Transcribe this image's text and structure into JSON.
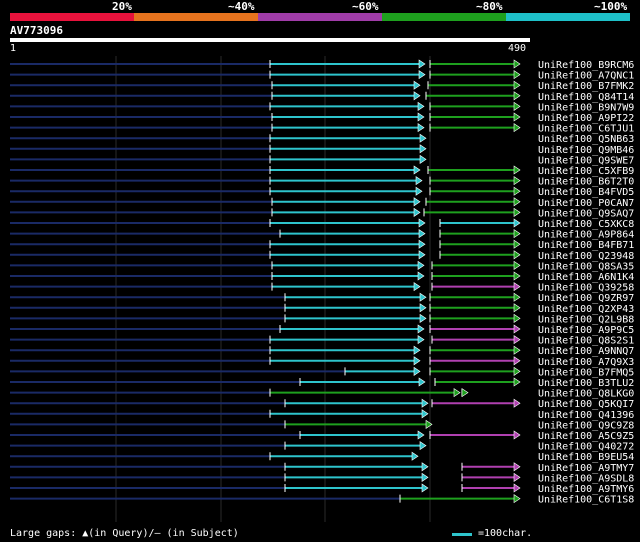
{
  "legend": {
    "colors": [
      "#e8123c",
      "#e6731e",
      "#a03ca8",
      "#1ea01e",
      "#1ec0c8"
    ],
    "labels": [
      "20%",
      "~40%",
      "~60%",
      "~80%",
      "~100%"
    ]
  },
  "query": {
    "id": "AV773096",
    "start": "1",
    "end": "490",
    "length": 490
  },
  "identity_colors": {
    "cyan": "#2ec4cc",
    "green": "#1ea01e",
    "magenta": "#b040b0",
    "navy": "#1a2a66"
  },
  "hits": [
    {
      "name": "UniRef100_B9RCM6",
      "segs": [
        [
          270,
          425,
          "cyan"
        ],
        [
          430,
          520,
          "green"
        ]
      ]
    },
    {
      "name": "UniRef100_A7QNC1",
      "segs": [
        [
          270,
          425,
          "cyan"
        ],
        [
          430,
          520,
          "green"
        ]
      ]
    },
    {
      "name": "UniRef100_B7FMK2",
      "segs": [
        [
          272,
          420,
          "cyan"
        ],
        [
          428,
          520,
          "green"
        ]
      ]
    },
    {
      "name": "UniRef100_Q84T14",
      "segs": [
        [
          272,
          420,
          "cyan"
        ],
        [
          426,
          520,
          "green"
        ]
      ]
    },
    {
      "name": "UniRef100_B9N7W9",
      "segs": [
        [
          270,
          424,
          "cyan"
        ],
        [
          430,
          520,
          "green"
        ]
      ]
    },
    {
      "name": "UniRef100_A9PI22",
      "segs": [
        [
          272,
          424,
          "cyan"
        ],
        [
          430,
          520,
          "green"
        ]
      ]
    },
    {
      "name": "UniRef100_C6TJU1",
      "segs": [
        [
          272,
          424,
          "cyan"
        ],
        [
          430,
          520,
          "green"
        ]
      ]
    },
    {
      "name": "UniRef100_Q5NB63",
      "segs": [
        [
          270,
          426,
          "cyan"
        ]
      ]
    },
    {
      "name": "UniRef100_Q9MB46",
      "segs": [
        [
          270,
          426,
          "cyan"
        ]
      ]
    },
    {
      "name": "UniRef100_Q9SWE7",
      "segs": [
        [
          270,
          426,
          "cyan"
        ]
      ]
    },
    {
      "name": "UniRef100_C5XFB9",
      "segs": [
        [
          270,
          420,
          "cyan"
        ],
        [
          428,
          520,
          "green"
        ]
      ]
    },
    {
      "name": "UniRef100_B6T2T0",
      "segs": [
        [
          270,
          422,
          "cyan"
        ],
        [
          430,
          520,
          "green"
        ]
      ]
    },
    {
      "name": "UniRef100_B4FVD5",
      "segs": [
        [
          270,
          422,
          "cyan"
        ],
        [
          430,
          520,
          "green"
        ]
      ]
    },
    {
      "name": "UniRef100_P0CAN7",
      "segs": [
        [
          272,
          420,
          "cyan"
        ],
        [
          426,
          520,
          "green"
        ]
      ]
    },
    {
      "name": "UniRef100_Q9SAQ7",
      "segs": [
        [
          272,
          420,
          "cyan"
        ],
        [
          424,
          520,
          "green"
        ]
      ]
    },
    {
      "name": "UniRef100_C5XKC8",
      "segs": [
        [
          270,
          425,
          "cyan"
        ],
        [
          440,
          520,
          "cyan"
        ]
      ]
    },
    {
      "name": "UniRef100_A9P864",
      "segs": [
        [
          280,
          425,
          "cyan"
        ],
        [
          440,
          520,
          "green"
        ]
      ]
    },
    {
      "name": "UniRef100_B4FB71",
      "segs": [
        [
          270,
          425,
          "cyan"
        ],
        [
          440,
          520,
          "green"
        ]
      ]
    },
    {
      "name": "UniRef100_Q23948",
      "segs": [
        [
          270,
          425,
          "cyan"
        ],
        [
          440,
          520,
          "green"
        ]
      ]
    },
    {
      "name": "UniRef100_Q8SA35",
      "segs": [
        [
          272,
          424,
          "cyan"
        ],
        [
          432,
          520,
          "green"
        ]
      ]
    },
    {
      "name": "UniRef100_A6N1K4",
      "segs": [
        [
          272,
          424,
          "cyan"
        ],
        [
          432,
          520,
          "green"
        ]
      ]
    },
    {
      "name": "UniRef100_Q39258",
      "segs": [
        [
          272,
          420,
          "cyan"
        ],
        [
          432,
          520,
          "magenta"
        ]
      ]
    },
    {
      "name": "UniRef100_Q9ZR97",
      "segs": [
        [
          285,
          426,
          "cyan"
        ],
        [
          430,
          520,
          "green"
        ]
      ]
    },
    {
      "name": "UniRef100_Q2XP43",
      "segs": [
        [
          285,
          426,
          "cyan"
        ],
        [
          430,
          520,
          "green"
        ]
      ]
    },
    {
      "name": "UniRef100_Q2L9B8",
      "segs": [
        [
          285,
          426,
          "cyan"
        ],
        [
          430,
          520,
          "green"
        ]
      ]
    },
    {
      "name": "UniRef100_A9P9C5",
      "segs": [
        [
          280,
          424,
          "cyan"
        ],
        [
          430,
          520,
          "magenta"
        ]
      ]
    },
    {
      "name": "UniRef100_Q8S2S1",
      "segs": [
        [
          270,
          424,
          "cyan"
        ],
        [
          432,
          520,
          "magenta"
        ]
      ]
    },
    {
      "name": "UniRef100_A9NNQ7",
      "segs": [
        [
          270,
          420,
          "cyan"
        ],
        [
          430,
          520,
          "green"
        ]
      ]
    },
    {
      "name": "UniRef100_A7Q9X3",
      "segs": [
        [
          270,
          420,
          "cyan"
        ],
        [
          430,
          520,
          "magenta"
        ]
      ]
    },
    {
      "name": "UniRef100_B7FMQ5",
      "segs": [
        [
          345,
          420,
          "cyan"
        ],
        [
          430,
          520,
          "green"
        ]
      ]
    },
    {
      "name": "UniRef100_B3TLU2",
      "segs": [
        [
          300,
          425,
          "cyan"
        ],
        [
          435,
          520,
          "green"
        ]
      ]
    },
    {
      "name": "UniRef100_Q8LKG0",
      "segs": [
        [
          270,
          460,
          "green"
        ],
        [
          462,
          468,
          "green"
        ]
      ]
    },
    {
      "name": "UniRef100_Q5KQI7",
      "segs": [
        [
          285,
          428,
          "cyan"
        ],
        [
          432,
          520,
          "magenta"
        ]
      ]
    },
    {
      "name": "UniRef100_Q41396",
      "segs": [
        [
          270,
          428,
          "cyan"
        ]
      ]
    },
    {
      "name": "UniRef100_Q9C9Z8",
      "segs": [
        [
          285,
          432,
          "green"
        ]
      ]
    },
    {
      "name": "UniRef100_A5C9Z5",
      "segs": [
        [
          300,
          424,
          "cyan"
        ],
        [
          430,
          520,
          "magenta"
        ]
      ]
    },
    {
      "name": "UniRef100_Q40272",
      "segs": [
        [
          285,
          426,
          "cyan"
        ]
      ]
    },
    {
      "name": "UniRef100_B9EU54",
      "segs": [
        [
          270,
          418,
          "cyan"
        ]
      ]
    },
    {
      "name": "UniRef100_A9TMY7",
      "segs": [
        [
          285,
          428,
          "cyan"
        ],
        [
          462,
          520,
          "magenta"
        ]
      ]
    },
    {
      "name": "UniRef100_A9SDL8",
      "segs": [
        [
          285,
          428,
          "cyan"
        ],
        [
          462,
          520,
          "magenta"
        ]
      ]
    },
    {
      "name": "UniRef100_A9TMY6",
      "segs": [
        [
          285,
          428,
          "cyan"
        ],
        [
          462,
          520,
          "magenta"
        ]
      ]
    },
    {
      "name": "UniRef100_C6T1S8",
      "segs": [
        [
          400,
          520,
          "green"
        ]
      ]
    }
  ],
  "footer": {
    "gaps_text": "Large gaps: ▲(in Query)/– (in Subject)",
    "scale_text": "=100char."
  }
}
